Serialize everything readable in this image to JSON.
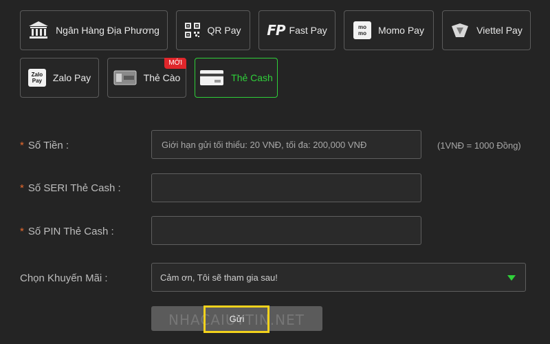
{
  "payment_methods": [
    {
      "label": "Ngân Hàng Địa Phương",
      "icon": "bank-icon"
    },
    {
      "label": "QR Pay",
      "icon": "qr-code-icon"
    },
    {
      "label": "Fast Pay",
      "icon": "fastpay-logo-icon",
      "icon_text": "FP"
    },
    {
      "label": "Momo Pay",
      "icon": "momo-logo-icon",
      "icon_text": "mo mo"
    },
    {
      "label": "Viettel Pay",
      "icon": "viettelpay-logo-icon"
    },
    {
      "label": "Zalo Pay",
      "icon": "zalopay-logo-icon",
      "icon_text": "Zalo Pay"
    },
    {
      "label": "Thẻ Cào",
      "icon": "scratch-card-icon",
      "badge": "MỚI"
    },
    {
      "label": "Thẻ Cash",
      "icon": "cash-card-icon",
      "active": true
    }
  ],
  "form": {
    "amount": {
      "required_mark": "*",
      "label": "Số Tiền :",
      "placeholder": "Giới hạn gửi tối thiểu: 20 VNĐ, tối đa: 200,000 VNĐ",
      "value": "",
      "note": "(1VNĐ = 1000 Đồng)"
    },
    "serial": {
      "required_mark": "*",
      "label": "Số SERI Thẻ Cash :",
      "value": ""
    },
    "pin": {
      "required_mark": "*",
      "label": "Số PIN Thẻ Cash :",
      "value": ""
    },
    "promotion": {
      "label": "Chọn Khuyến Mãi :",
      "selected": "Cảm ơn, Tôi sẽ tham gia sau!"
    },
    "submit_label": "Gửi"
  },
  "watermark": "NHACAIUYTIN.NET",
  "colors": {
    "background": "#242424",
    "accent_green": "#2fd13a",
    "required_orange": "#e56a2e",
    "badge_red": "#e0262b",
    "highlight_yellow": "#f3d21c"
  }
}
